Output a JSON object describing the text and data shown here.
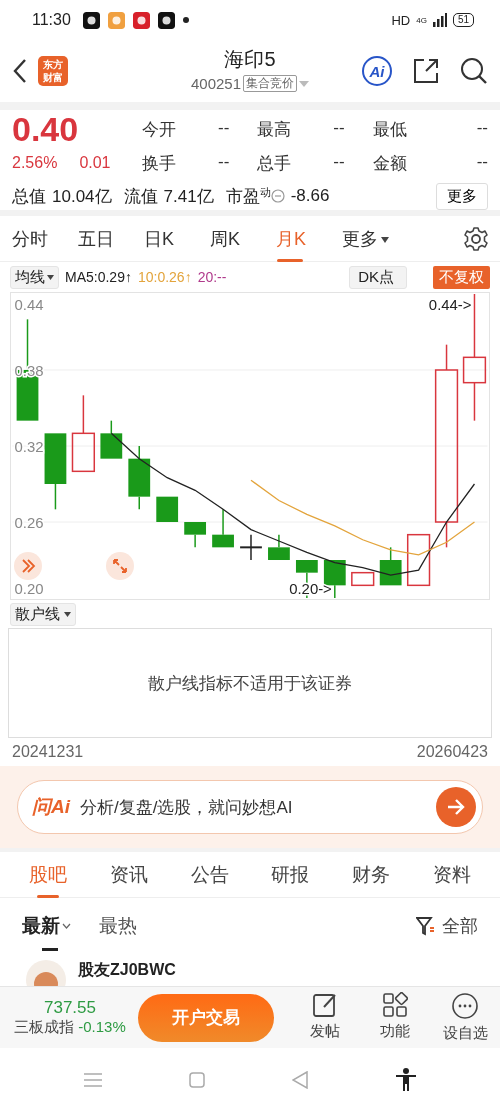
{
  "status_bar": {
    "time": "11:30",
    "network": "HD",
    "signal_label": "4G",
    "battery": "51"
  },
  "header": {
    "logo_lines": [
      "东方",
      "财富"
    ],
    "title": "海印5",
    "code": "400251",
    "tag": "集合竞价",
    "ai_badge": "Ai"
  },
  "quote": {
    "price": "0.40",
    "change_pct": "2.56%",
    "change": "0.01",
    "stats": [
      {
        "label": "今开",
        "value": "--"
      },
      {
        "label": "最高",
        "value": "--"
      },
      {
        "label": "最低",
        "value": "--"
      },
      {
        "label": "换手",
        "value": "--"
      },
      {
        "label": "总手",
        "value": "--"
      },
      {
        "label": "金额",
        "value": "--"
      }
    ],
    "summary": [
      {
        "label": "总值",
        "value": "10.04亿"
      },
      {
        "label": "流值",
        "value": "7.41亿"
      },
      {
        "label": "市盈",
        "sup": "动",
        "value": "-8.66",
        "kind": "info"
      }
    ],
    "more_button": "更多"
  },
  "period_tabs": [
    {
      "label": "分时",
      "selected": false
    },
    {
      "label": "五日",
      "selected": false
    },
    {
      "label": "日K",
      "selected": false
    },
    {
      "label": "周K",
      "selected": false
    },
    {
      "label": "月K",
      "selected": true
    },
    {
      "label": "更多",
      "selected": false,
      "kind": "dropdown"
    }
  ],
  "chart_toolbar": {
    "ma_dropdown": "均线",
    "ma_readings": [
      {
        "text": "MA5:0.29↑",
        "color": "#222222"
      },
      {
        "text": "10:0.26↑",
        "color": "#e3a43c"
      },
      {
        "text": "20:--",
        "color": "#b03a8c"
      }
    ],
    "dk_button": "DK点",
    "adjust_button": "不复权"
  },
  "kline": {
    "chart_data": {
      "type": "line",
      "ylim": [
        0.2,
        0.44
      ],
      "grid": true,
      "yticks": [
        {
          "value": 0.44,
          "label": "0.44"
        },
        {
          "value": 0.38,
          "label": "0.38"
        },
        {
          "value": 0.32,
          "label": "0.32"
        },
        {
          "value": 0.26,
          "label": "0.26"
        },
        {
          "value": 0.2,
          "label": "0.20"
        }
      ],
      "series": [
        {
          "color": "#222222",
          "values": [
            null,
            null,
            null,
            0.33,
            0.31,
            0.295,
            0.285,
            0.27,
            0.254,
            0.245,
            0.236,
            0.228,
            0.224,
            0.218,
            0.222,
            0.26,
            0.29
          ]
        },
        {
          "color": "#e3a43c",
          "values": [
            null,
            null,
            null,
            null,
            null,
            null,
            null,
            null,
            0.293,
            0.277,
            0.266,
            0.257,
            0.246,
            0.238,
            0.234,
            0.244,
            0.26
          ]
        }
      ],
      "annotations": [
        {
          "text": "0.44->"
        },
        {
          "text": "0.20->"
        }
      ]
    }
  },
  "indicator": {
    "dropdown": "散户线",
    "message": "散户线指标不适用于该证券",
    "start_date": "20241231",
    "end_date": "20260423"
  },
  "ai_bar": {
    "logo": "问Ai",
    "prompt": "分析/复盘/选股，就问妙想AI"
  },
  "info_tabs": [
    {
      "label": "股吧",
      "selected": true
    },
    {
      "label": "资讯",
      "selected": false
    },
    {
      "label": "公告",
      "selected": false
    },
    {
      "label": "研报",
      "selected": false
    },
    {
      "label": "财务",
      "selected": false
    },
    {
      "label": "资料",
      "selected": false
    }
  ],
  "sort_tabs": [
    {
      "label": "最新",
      "selected": true
    },
    {
      "label": "最热",
      "selected": false
    }
  ],
  "filter": "全部",
  "post": {
    "author": "股友ZJ0BWC"
  },
  "bottom_bar": {
    "index_value": "737.55",
    "index_name": "三板成指",
    "index_change": "-0.13%",
    "trade_button": "开户交易",
    "actions": [
      {
        "label": "发帖",
        "kind": "edit"
      },
      {
        "label": "功能",
        "kind": "apps"
      },
      {
        "label": "设自选",
        "kind": "more"
      }
    ]
  }
}
